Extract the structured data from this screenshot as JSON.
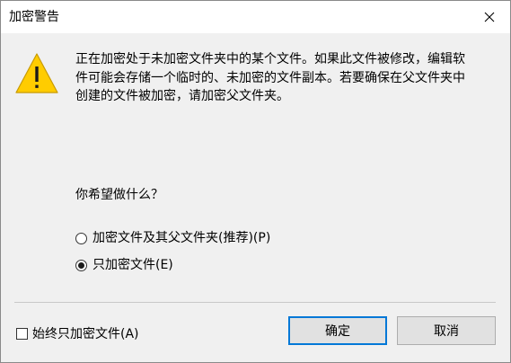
{
  "window": {
    "title": "加密警告",
    "close_icon": "close-icon"
  },
  "message": {
    "icon": "warning-icon",
    "lines": [
      "正在加密处于未加密文件夹中的某个文件。如果此文件被修改，编辑软",
      "件可能会存储一个临时的、未加密的文件副本。若要确保在父文件夹中",
      "创建的文件被加密，请加密父文件夹。"
    ]
  },
  "question": "你希望做什么？",
  "options": [
    {
      "label": "加密文件及其父文件夹(推荐)(P)",
      "checked": false
    },
    {
      "label": "只加密文件(E)",
      "checked": true
    }
  ],
  "always_checkbox": {
    "label": "始终只加密文件(A)",
    "checked": false
  },
  "buttons": {
    "ok": "确定",
    "cancel": "取消"
  },
  "colors": {
    "warning_fill": "#ffcc00",
    "default_button_border": "#0078d7"
  }
}
